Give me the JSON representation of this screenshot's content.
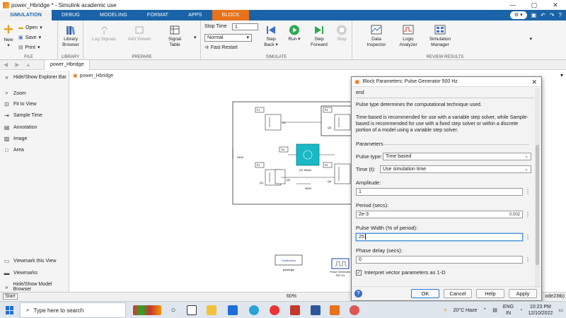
{
  "window": {
    "title": "power_Hbridge * - Simulink academic use"
  },
  "tabs": [
    "SIMULATION",
    "DEBUG",
    "MODELING",
    "FORMAT",
    "APPS",
    "BLOCK"
  ],
  "ribbon": {
    "file": {
      "new": "New",
      "open": "Open",
      "save": "Save",
      "print": "Print",
      "group": "FILE"
    },
    "library": {
      "browser": "Library Browser",
      "group": "LIBRARY"
    },
    "prepare": {
      "log_signals": "Log Signals",
      "add_viewer": "Add Viewer",
      "signal_table": "Signal Table",
      "group": "PREPARE"
    },
    "simulate": {
      "stop_time_label": "Stop Time",
      "stop_time_value": "1",
      "mode": "Normal",
      "fast_restart": "Fast Restart",
      "step_back": "Step Back",
      "run": "Run",
      "step_forward": "Step Forward",
      "stop": "Stop",
      "group": "SIMULATE"
    },
    "review": {
      "data_inspector": "Data Inspector",
      "logic_analyzer": "Logic Analyzer",
      "sim_manager": "Simulation Manager",
      "group": "REVIEW RESULTS"
    }
  },
  "addressbar": {
    "tab": "power_Hbridge"
  },
  "breadcrumb": "power_Hbridge",
  "sidebar": {
    "top": "Hide/Show Explorer Bar",
    "items": [
      "Zoom",
      "Fit to View",
      "Sample Time",
      "Annotation",
      "Image",
      "Area"
    ],
    "bottom": [
      "Viewmark this View",
      "Viewmarks",
      "Hide/Show Model Browser"
    ]
  },
  "diagram": {
    "labels": {
      "src": "240V",
      "motor": "DC Motor",
      "vbat": "300V",
      "d1": "D1",
      "q1": "Q1",
      "q2": "Q2",
      "q3": "Q3",
      "q4": "Q4",
      "tm": "Tm"
    },
    "continuous_block": "Continuous",
    "powergui_label": "powergui",
    "pulse_block_label": "Pulse Generator 500 Hz"
  },
  "status": {
    "start": "Start",
    "zoom": "60%",
    "solver": "ode23tb)"
  },
  "dialog": {
    "title": "Block Parameters: Pulse Generator 500 Hz",
    "end_text": "end",
    "desc1": "Pulse type determines the computational technique used.",
    "desc2": "Time-based is recommended for use with a variable step solver, while Sample-based is recommended for use with a fixed step solver or within a discrete portion of a model using a variable step solver.",
    "parameters_label": "Parameters",
    "pulse_type_label": "Pulse type:",
    "pulse_type_value": "Time based",
    "time_label": "Time (t):",
    "time_value": "Use simulation time",
    "amplitude_label": "Amplitude:",
    "amplitude_value": "1",
    "period_label": "Period (secs):",
    "period_value": "2e-3",
    "period_hint": "0.002",
    "width_label": "Pulse Width (% of period):",
    "width_value": "25",
    "phase_label": "Phase delay (secs):",
    "phase_value": "0",
    "interpret_label": "Interpret vector parameters as 1-D",
    "interpret_checked": true,
    "buttons": {
      "ok": "OK",
      "cancel": "Cancel",
      "help": "Help",
      "apply": "Apply"
    }
  },
  "taskbar": {
    "search_placeholder": "Type here to search",
    "weather": "20°C  Haze",
    "lang1": "ENG",
    "lang2": "IN",
    "time": "10:23 PM",
    "date": "12/10/2022"
  }
}
